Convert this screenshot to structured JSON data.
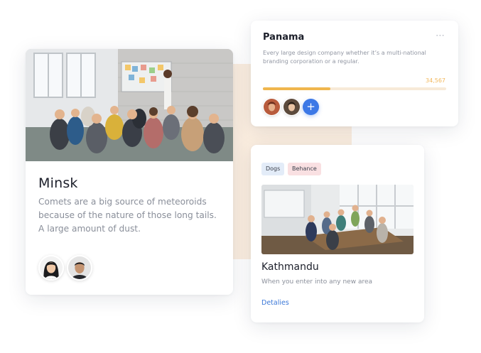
{
  "minsk": {
    "title": "Minsk",
    "description": "Comets are a big source of meteoroids because of the nature of those long tails. A large amount of dust.",
    "avatars": [
      "avatar-woman",
      "avatar-man"
    ]
  },
  "panama": {
    "title": "Panama",
    "more_icon": "⋯",
    "description": "Every large design company whether it’s a multi-national branding corporation or a regular.",
    "count": "34,567",
    "progress": 0.37,
    "add_symbol": "+"
  },
  "kathmandu": {
    "tags": [
      "Dogs",
      "Behance"
    ],
    "title": "Kathmandu",
    "description": "When you enter into any new area",
    "link": "Detalies"
  },
  "colors": {
    "accent_blue": "#3c78e6",
    "progress_fill": "#f0b64e",
    "progress_track": "#f7ead8",
    "background_shape": "#fbeee0"
  }
}
